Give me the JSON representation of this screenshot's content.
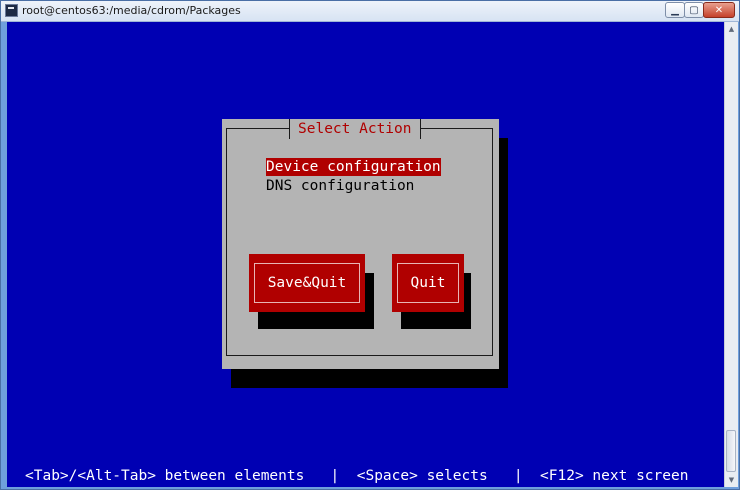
{
  "window": {
    "title": "root@centos63:/media/cdrom/Packages",
    "minimize_glyph": "▁",
    "maximize_glyph": "▢",
    "close_glyph": "✕"
  },
  "dialog": {
    "title": "Select Action",
    "items": [
      {
        "label": "Device configuration",
        "selected": true
      },
      {
        "label": "DNS configuration",
        "selected": false
      }
    ],
    "buttons": {
      "save_quit": "Save&Quit",
      "quit": "Quit"
    }
  },
  "statusbar": {
    "text": "<Tab>/<Alt-Tab> between elements   |  <Space> selects   |  <F12> next screen"
  },
  "colors": {
    "terminal_bg": "#0000b3",
    "dialog_bg": "#b4b4b4",
    "accent_red": "#b00000"
  }
}
